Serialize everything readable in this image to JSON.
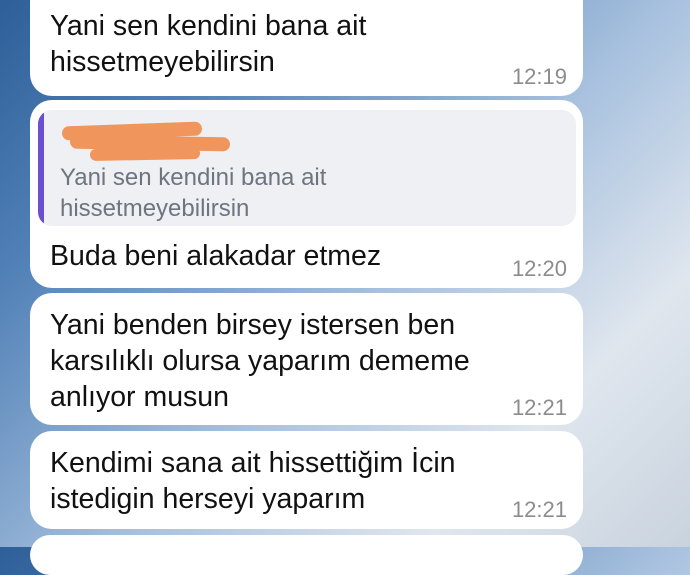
{
  "messages": [
    {
      "text": "Yani sen kendini bana ait\nhissetmeyebilirsin",
      "time": "12:19"
    },
    {
      "quote": {
        "text": "Yani sen kendini bana ait\nhissetmeyebilirsin"
      },
      "text": "Buda beni alakadar etmez",
      "time": "12:20"
    },
    {
      "text": "Yani benden birsey istersen ben\nkarsılıklı olursa yaparım dememe\nanlıyor musun",
      "time": "12:21"
    },
    {
      "text": "Kendimi sana ait hissettiğim İcin\nistedigin herseyi yaparım",
      "time": "12:21"
    }
  ],
  "colors": {
    "bubble": "#ffffff",
    "quote_bar": "#6b4fcf",
    "quote_bg": "#eef0f3",
    "time_text": "#8c8c8c",
    "redaction": "#f0955c"
  }
}
